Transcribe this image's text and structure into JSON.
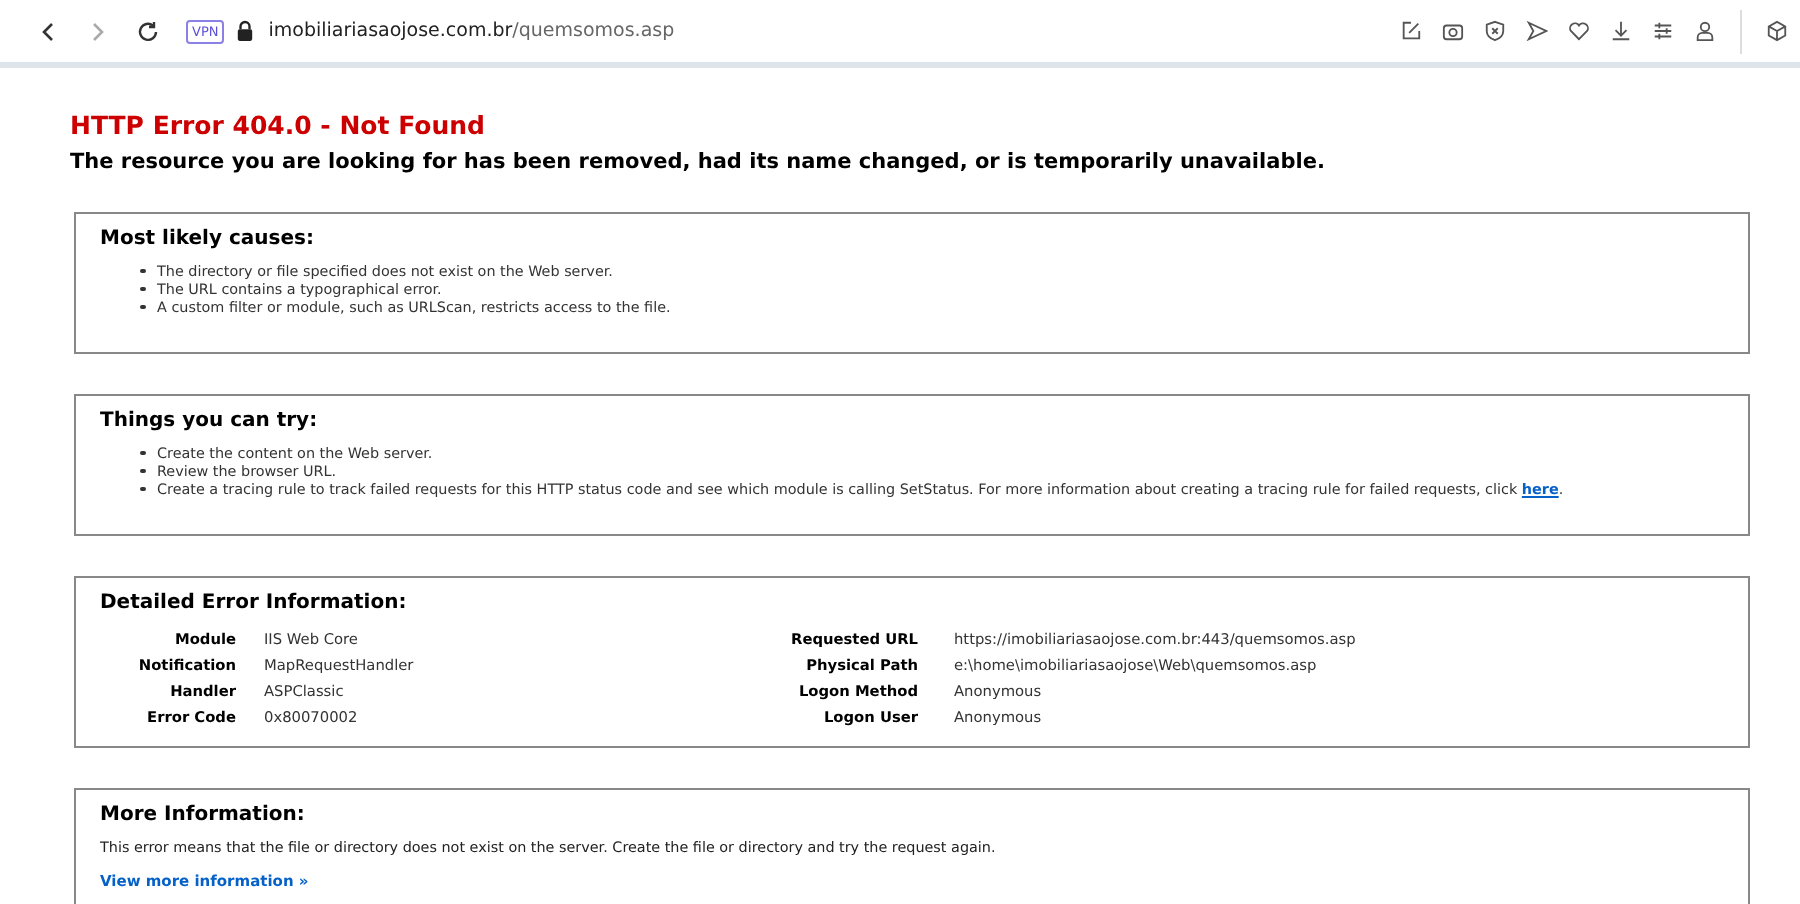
{
  "browser": {
    "vpn_badge": "VPN",
    "url": {
      "host": "imobiliariasaojose.com.br",
      "path": "/quemsomos.asp"
    }
  },
  "page": {
    "title": "HTTP Error 404.0 - Not Found",
    "subtitle": "The resource you are looking for has been removed, had its name changed, or is temporarily unavailable.",
    "causes": {
      "heading": "Most likely causes:",
      "items": [
        "The directory or file specified does not exist on the Web server.",
        "The URL contains a typographical error.",
        "A custom filter or module, such as URLScan, restricts access to the file."
      ]
    },
    "try": {
      "heading": "Things you can try:",
      "items": [
        {
          "text": "Create the content on the Web server."
        },
        {
          "text": "Review the browser URL."
        },
        {
          "text": "Create a tracing rule to track failed requests for this HTTP status code and see which module is calling SetStatus. For more information about creating a tracing rule for failed requests, click",
          "link": "here",
          "after": "."
        }
      ]
    },
    "details": {
      "heading": "Detailed Error Information:",
      "left": [
        {
          "label": "Module",
          "value": "IIS Web Core"
        },
        {
          "label": "Notification",
          "value": "MapRequestHandler"
        },
        {
          "label": "Handler",
          "value": "ASPClassic"
        },
        {
          "label": "Error Code",
          "value": "0x80070002"
        }
      ],
      "right": [
        {
          "label": "Requested URL",
          "value": "https://imobiliariasaojose.com.br:443/quemsomos.asp"
        },
        {
          "label": "Physical Path",
          "value": "e:\\home\\imobiliariasaojose\\Web\\quemsomos.asp"
        },
        {
          "label": "Logon Method",
          "value": "Anonymous"
        },
        {
          "label": "Logon User",
          "value": "Anonymous"
        }
      ]
    },
    "more": {
      "heading": "More Information:",
      "text": "This error means that the file or directory does not exist on the server. Create the file or directory and try the request again.",
      "link": "View more information »"
    }
  }
}
